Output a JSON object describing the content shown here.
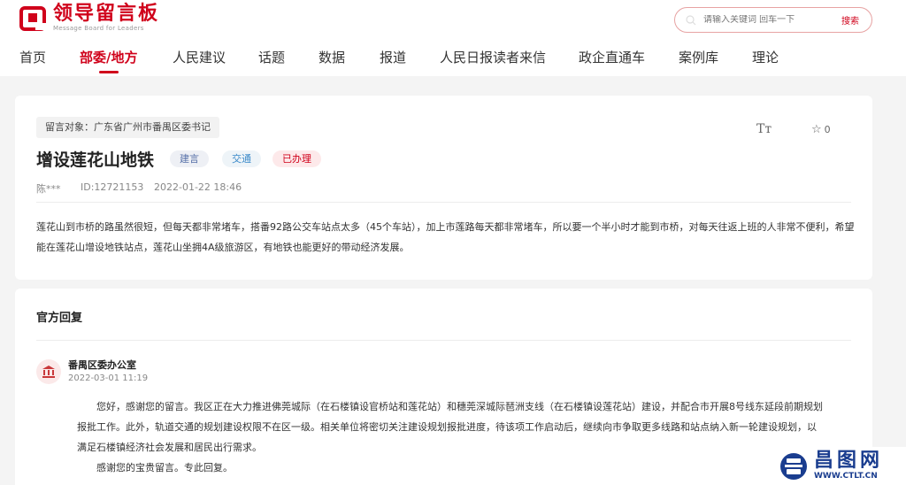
{
  "header": {
    "logo_cn": "领导留言板",
    "logo_en": "Message Board for Leaders",
    "search_placeholder": "请输入关键词 回车一下",
    "search_button": "搜索"
  },
  "nav": {
    "items": [
      "首页",
      "部委/地方",
      "人民建议",
      "话题",
      "数据",
      "报道",
      "人民日报读者来信",
      "政企直通车",
      "案例库",
      "理论"
    ],
    "active_index": 1
  },
  "message": {
    "target": "留言对象：广东省广州市番禺区委书记",
    "title": "增设莲花山地铁",
    "tags": [
      "建言",
      "交通",
      "已办理"
    ],
    "author": "陈***",
    "id": "ID:12721153",
    "date": "2022-01-22 18:46",
    "font_toggle": "Tт",
    "favorites": "0",
    "content": "莲花山到市桥的路虽然很短，但每天都非常堵车，搭番92路公交车站点太多（45个车站），加上市莲路每天都非常堵车，所以要一个半小时才能到市桥，对每天往返上班的人非常不便利，希望能在莲花山增设地铁站点，莲花山坐拥4A级旅游区，有地铁也能更好的带动经济发展。"
  },
  "reply": {
    "heading": "官方回复",
    "office": "番禺区委办公室",
    "date": "2022-03-01 11:19",
    "para1": "您好，感谢您的留言。我区正在大力推进佛莞城际（在石楼镇设官桥站和莲花站）和穗莞深城际琶洲支线（在石楼镇设莲花站）建设，并配合市开展8号线东延段前期规划",
    "para1b": "报批工作。此外，轨道交通的规划建设权限不在区一级。相关单位将密切关注建设规划报批进度，待该项工作启动后，继续向市争取更多线路和站点纳入新一轮建设规划，以",
    "para1c": "满足石楼镇经济社会发展和居民出行需求。",
    "para2": "感谢您的宝贵留言。专此回复。"
  },
  "watermark": {
    "cn": "昌图网",
    "en": "WWW.CTLT.CN"
  },
  "colors": {
    "brand_red": "#d0021b",
    "watermark_blue": "#1a3d8f"
  }
}
